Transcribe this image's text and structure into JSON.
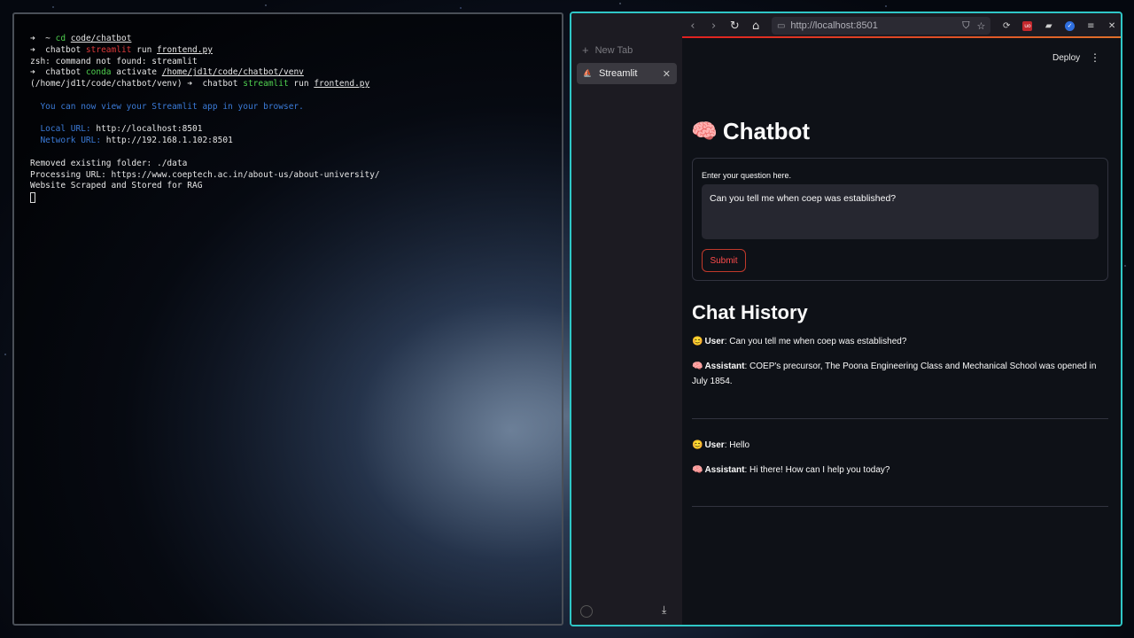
{
  "terminal": {
    "lines": [
      {
        "parts": [
          {
            "t": "➜  ~ ",
            "c": ""
          },
          {
            "t": "cd",
            "c": "t-green"
          },
          {
            "t": " ",
            "c": ""
          },
          {
            "t": "code/chatbot",
            "c": "t-ul"
          }
        ]
      },
      {
        "parts": [
          {
            "t": "➜  chatbot ",
            "c": ""
          },
          {
            "t": "streamlit",
            "c": "t-red"
          },
          {
            "t": " run ",
            "c": ""
          },
          {
            "t": "frontend.py",
            "c": "t-ul"
          }
        ]
      },
      {
        "parts": [
          {
            "t": "zsh: command not found: streamlit",
            "c": ""
          }
        ]
      },
      {
        "parts": [
          {
            "t": "➜  chatbot ",
            "c": ""
          },
          {
            "t": "conda",
            "c": "t-green"
          },
          {
            "t": " activate ",
            "c": ""
          },
          {
            "t": "/home/jd1t/code/chatbot/venv",
            "c": "t-ul"
          }
        ]
      },
      {
        "parts": [
          {
            "t": "(/home/jd1t/code/chatbot/venv) ➜  chatbot ",
            "c": ""
          },
          {
            "t": "streamlit",
            "c": "t-green"
          },
          {
            "t": " run ",
            "c": ""
          },
          {
            "t": "frontend.py",
            "c": "t-ul"
          }
        ]
      },
      {
        "parts": [
          {
            "t": "",
            "c": ""
          }
        ]
      },
      {
        "parts": [
          {
            "t": "  You can now view your Streamlit app in your browser.",
            "c": "t-blue"
          }
        ]
      },
      {
        "parts": [
          {
            "t": "",
            "c": ""
          }
        ]
      },
      {
        "parts": [
          {
            "t": "  Local URL: ",
            "c": "t-blue"
          },
          {
            "t": "http://localhost:8501",
            "c": ""
          }
        ]
      },
      {
        "parts": [
          {
            "t": "  Network URL: ",
            "c": "t-blue"
          },
          {
            "t": "http://192.168.1.102:8501",
            "c": ""
          }
        ]
      },
      {
        "parts": [
          {
            "t": "",
            "c": ""
          }
        ]
      },
      {
        "parts": [
          {
            "t": "Removed existing folder: ./data",
            "c": ""
          }
        ]
      },
      {
        "parts": [
          {
            "t": "Processing URL: https://www.coeptech.ac.in/about-us/about-university/",
            "c": ""
          }
        ]
      },
      {
        "parts": [
          {
            "t": "Website Scraped and Stored for RAG",
            "c": ""
          }
        ]
      }
    ]
  },
  "browser": {
    "new_tab_label": "New Tab",
    "tab_label": "Streamlit",
    "url": "http://localhost:8501",
    "deploy_label": "Deploy",
    "page_title": "Chatbot",
    "form_label": "Enter your question here.",
    "question_value": "Can you tell me when coep was established?",
    "submit_label": "Submit",
    "history_title": "Chat History",
    "chat": [
      {
        "user_label": "User",
        "user_text": "Can you tell me when coep was established?",
        "assistant_label": "Assistant",
        "assistant_text": "COEP's precursor, The Poona Engineering Class and Mechanical School was opened in July 1854."
      },
      {
        "user_label": "User",
        "user_text": "Hello",
        "assistant_label": "Assistant",
        "assistant_text": "Hi there! How can I help you today?"
      }
    ]
  },
  "colors": {
    "terminal_border": "#4a4f57",
    "browser_border": "#2fc7c7",
    "accent_red": "#ff4b4b"
  }
}
